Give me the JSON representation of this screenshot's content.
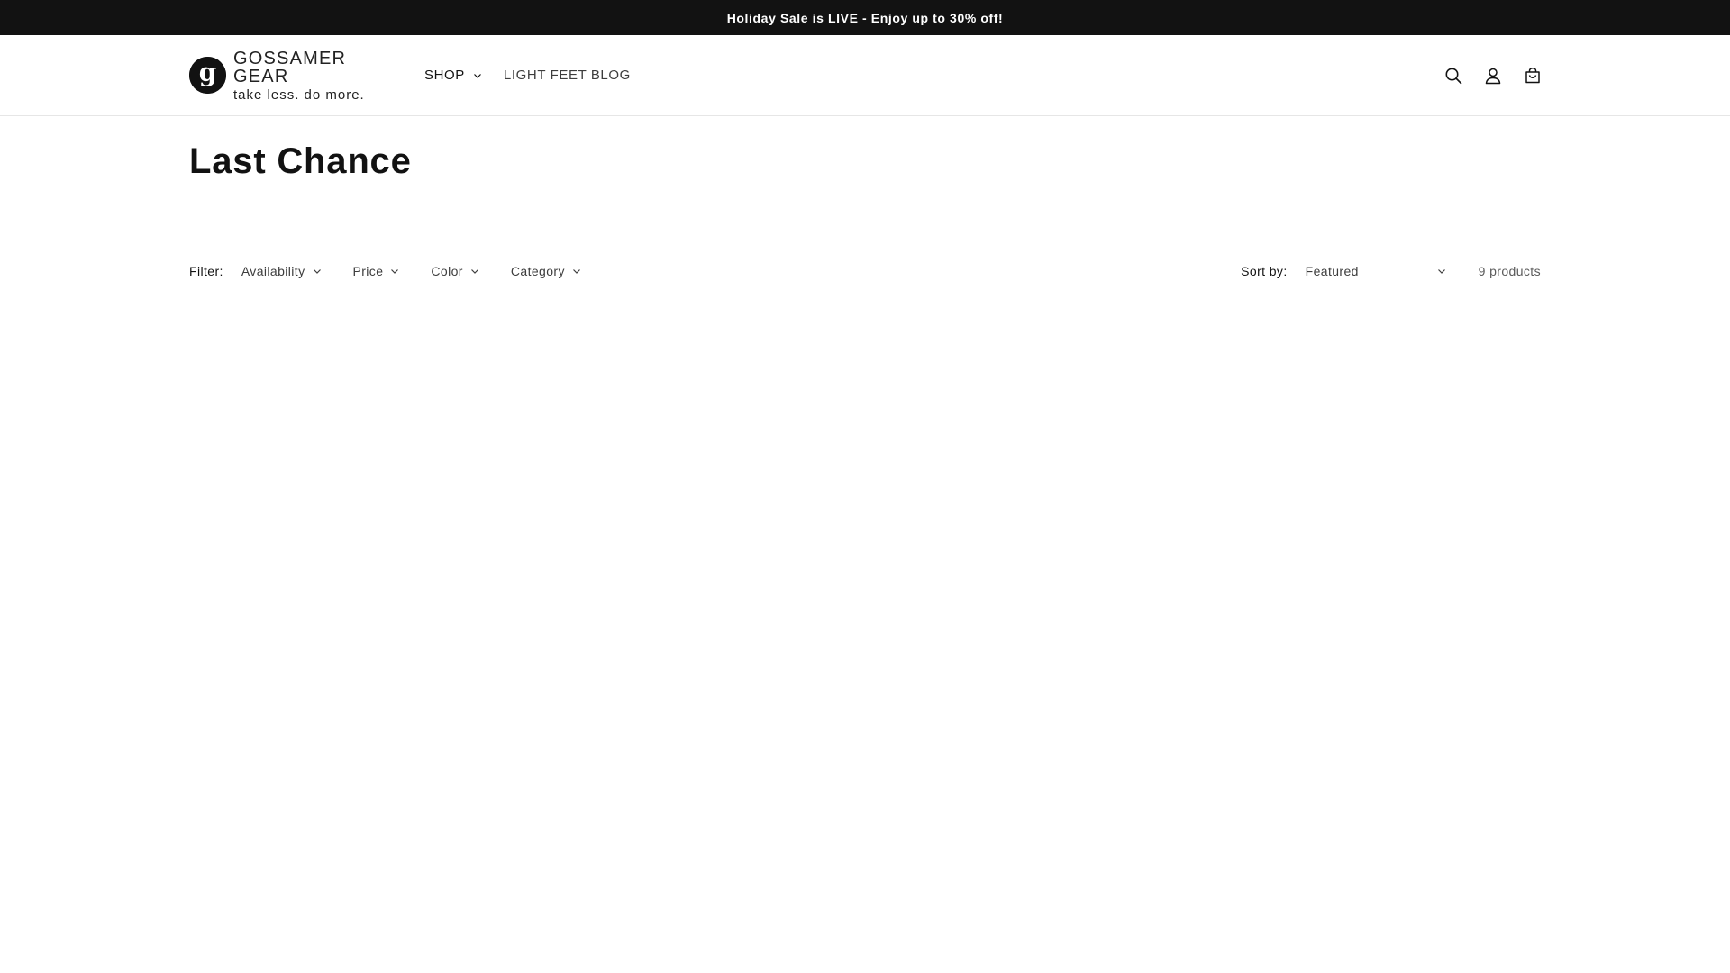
{
  "announcement": {
    "text": "Holiday Sale is LIVE - Enjoy up to 30% off!"
  },
  "header": {
    "logo": {
      "name": "GOSSAMER GEAR",
      "tagline": "take less. do more."
    },
    "nav": [
      {
        "label": "SHOP",
        "has_dropdown": true
      },
      {
        "label": "LIGHT FEET BLOG",
        "has_dropdown": false
      }
    ],
    "icons": [
      "search-icon",
      "account-icon",
      "cart-icon"
    ]
  },
  "collection": {
    "title": "Last Chance",
    "filter_label": "Filter:",
    "filters": [
      {
        "label": "Availability"
      },
      {
        "label": "Price"
      },
      {
        "label": "Color"
      },
      {
        "label": "Category"
      }
    ],
    "sort_label": "Sort by:",
    "sort_value": "Featured",
    "product_count": "9 products"
  },
  "colors": {
    "announcement_bg": "#121212",
    "text_primary": "#121212",
    "text_secondary": "#3d3d3d"
  }
}
